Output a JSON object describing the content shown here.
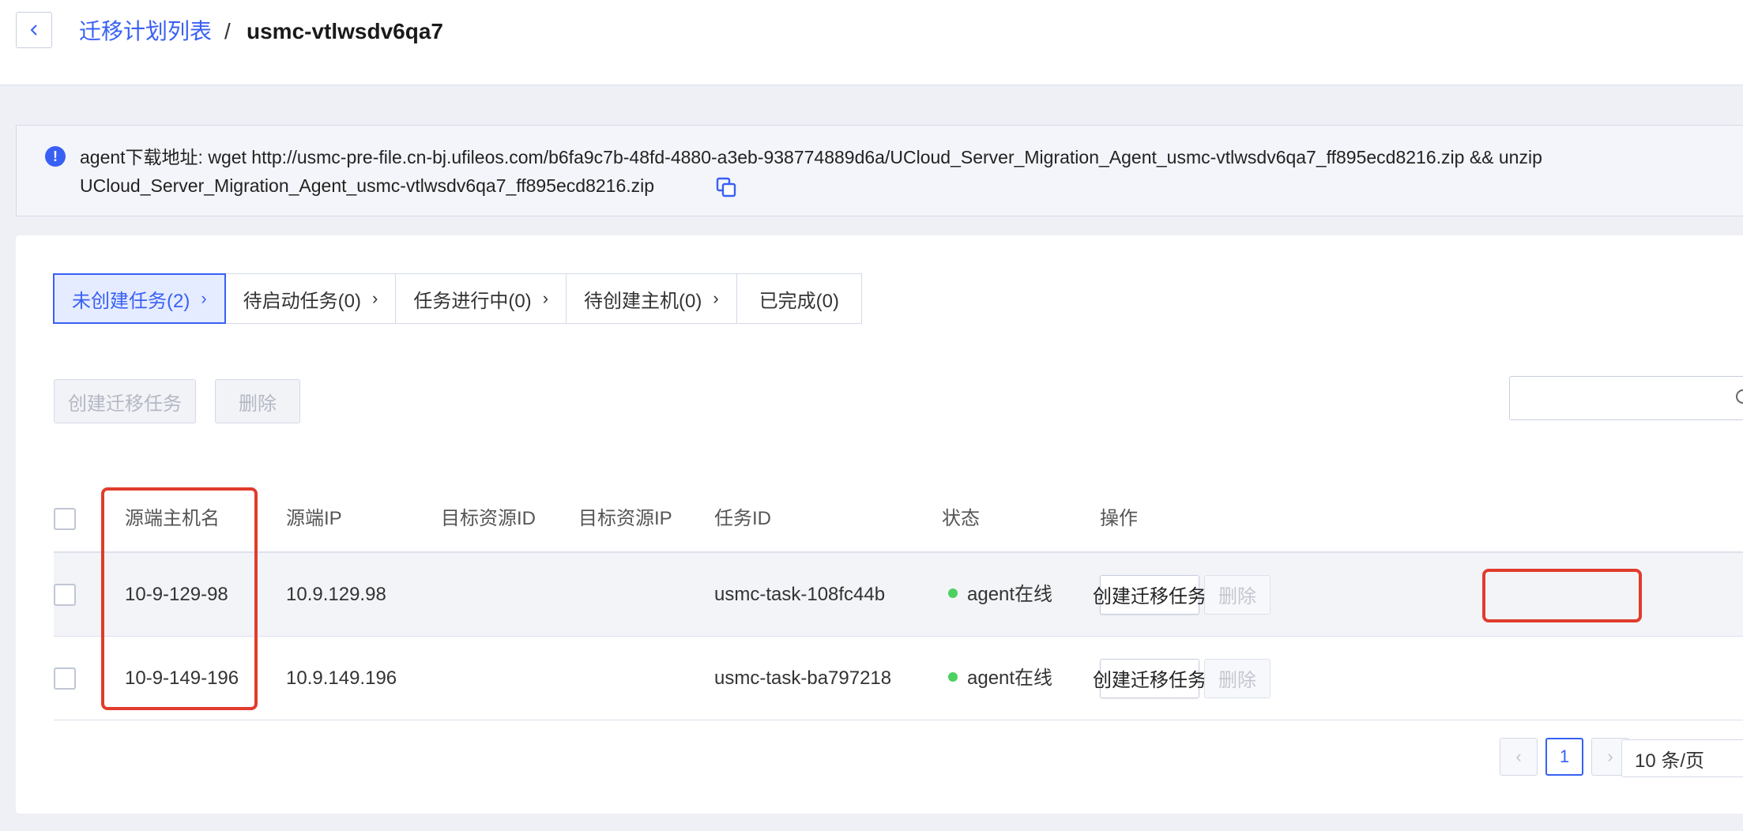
{
  "breadcrumb": {
    "parent": "迁移计划列表",
    "separator": "/",
    "current": "usmc-vtlwsdv6qa7"
  },
  "notice": {
    "line1": "agent下载地址: wget http://usmc-pre-file.cn-bj.ufileos.com/b6fa9c7b-48fd-4880-a3eb-938774889d6a/UCloud_Server_Migration_Agent_usmc-vtlwsdv6qa7_ff895ecd8216.zip && unzip",
    "line2": "UCloud_Server_Migration_Agent_usmc-vtlwsdv6qa7_ff895ecd8216.zip",
    "icon": "info-icon",
    "copy_icon": "copy-icon"
  },
  "tabs": [
    {
      "label": "未创建任务(2)",
      "active": true,
      "chevron": "›"
    },
    {
      "label": "待启动任务(0)",
      "active": false,
      "chevron": "›"
    },
    {
      "label": "任务进行中(0)",
      "active": false,
      "chevron": "›"
    },
    {
      "label": "待创建主机(0)",
      "active": false,
      "chevron": "›"
    },
    {
      "label": "已完成(0)",
      "active": false,
      "chevron": ""
    }
  ],
  "toolbar": {
    "create_label": "创建迁移任务",
    "delete_label": "删除",
    "search_placeholder": ""
  },
  "table": {
    "columns": [
      "源端主机名",
      "源端IP",
      "目标资源ID",
      "目标资源IP",
      "任务ID",
      "状态",
      "操作"
    ],
    "rows": [
      {
        "hostname": "10-9-129-98",
        "ip": "10.9.129.98",
        "target_id": "",
        "target_ip": "",
        "task_id": "usmc-task-108fc44b",
        "status": "agent在线",
        "create_label": "创建迁移任务",
        "delete_label": "删除"
      },
      {
        "hostname": "10-9-149-196",
        "ip": "10.9.149.196",
        "target_id": "",
        "target_ip": "",
        "task_id": "usmc-task-ba797218",
        "status": "agent在线",
        "create_label": "创建迁移任务",
        "delete_label": "删除"
      }
    ]
  },
  "pagination": {
    "prev": "‹",
    "current_page": "1",
    "next": "›",
    "page_size": "10 条/页"
  },
  "colors": {
    "accent": "#3860f4",
    "status_online": "#4cd060",
    "highlight": "#e03c2c"
  }
}
